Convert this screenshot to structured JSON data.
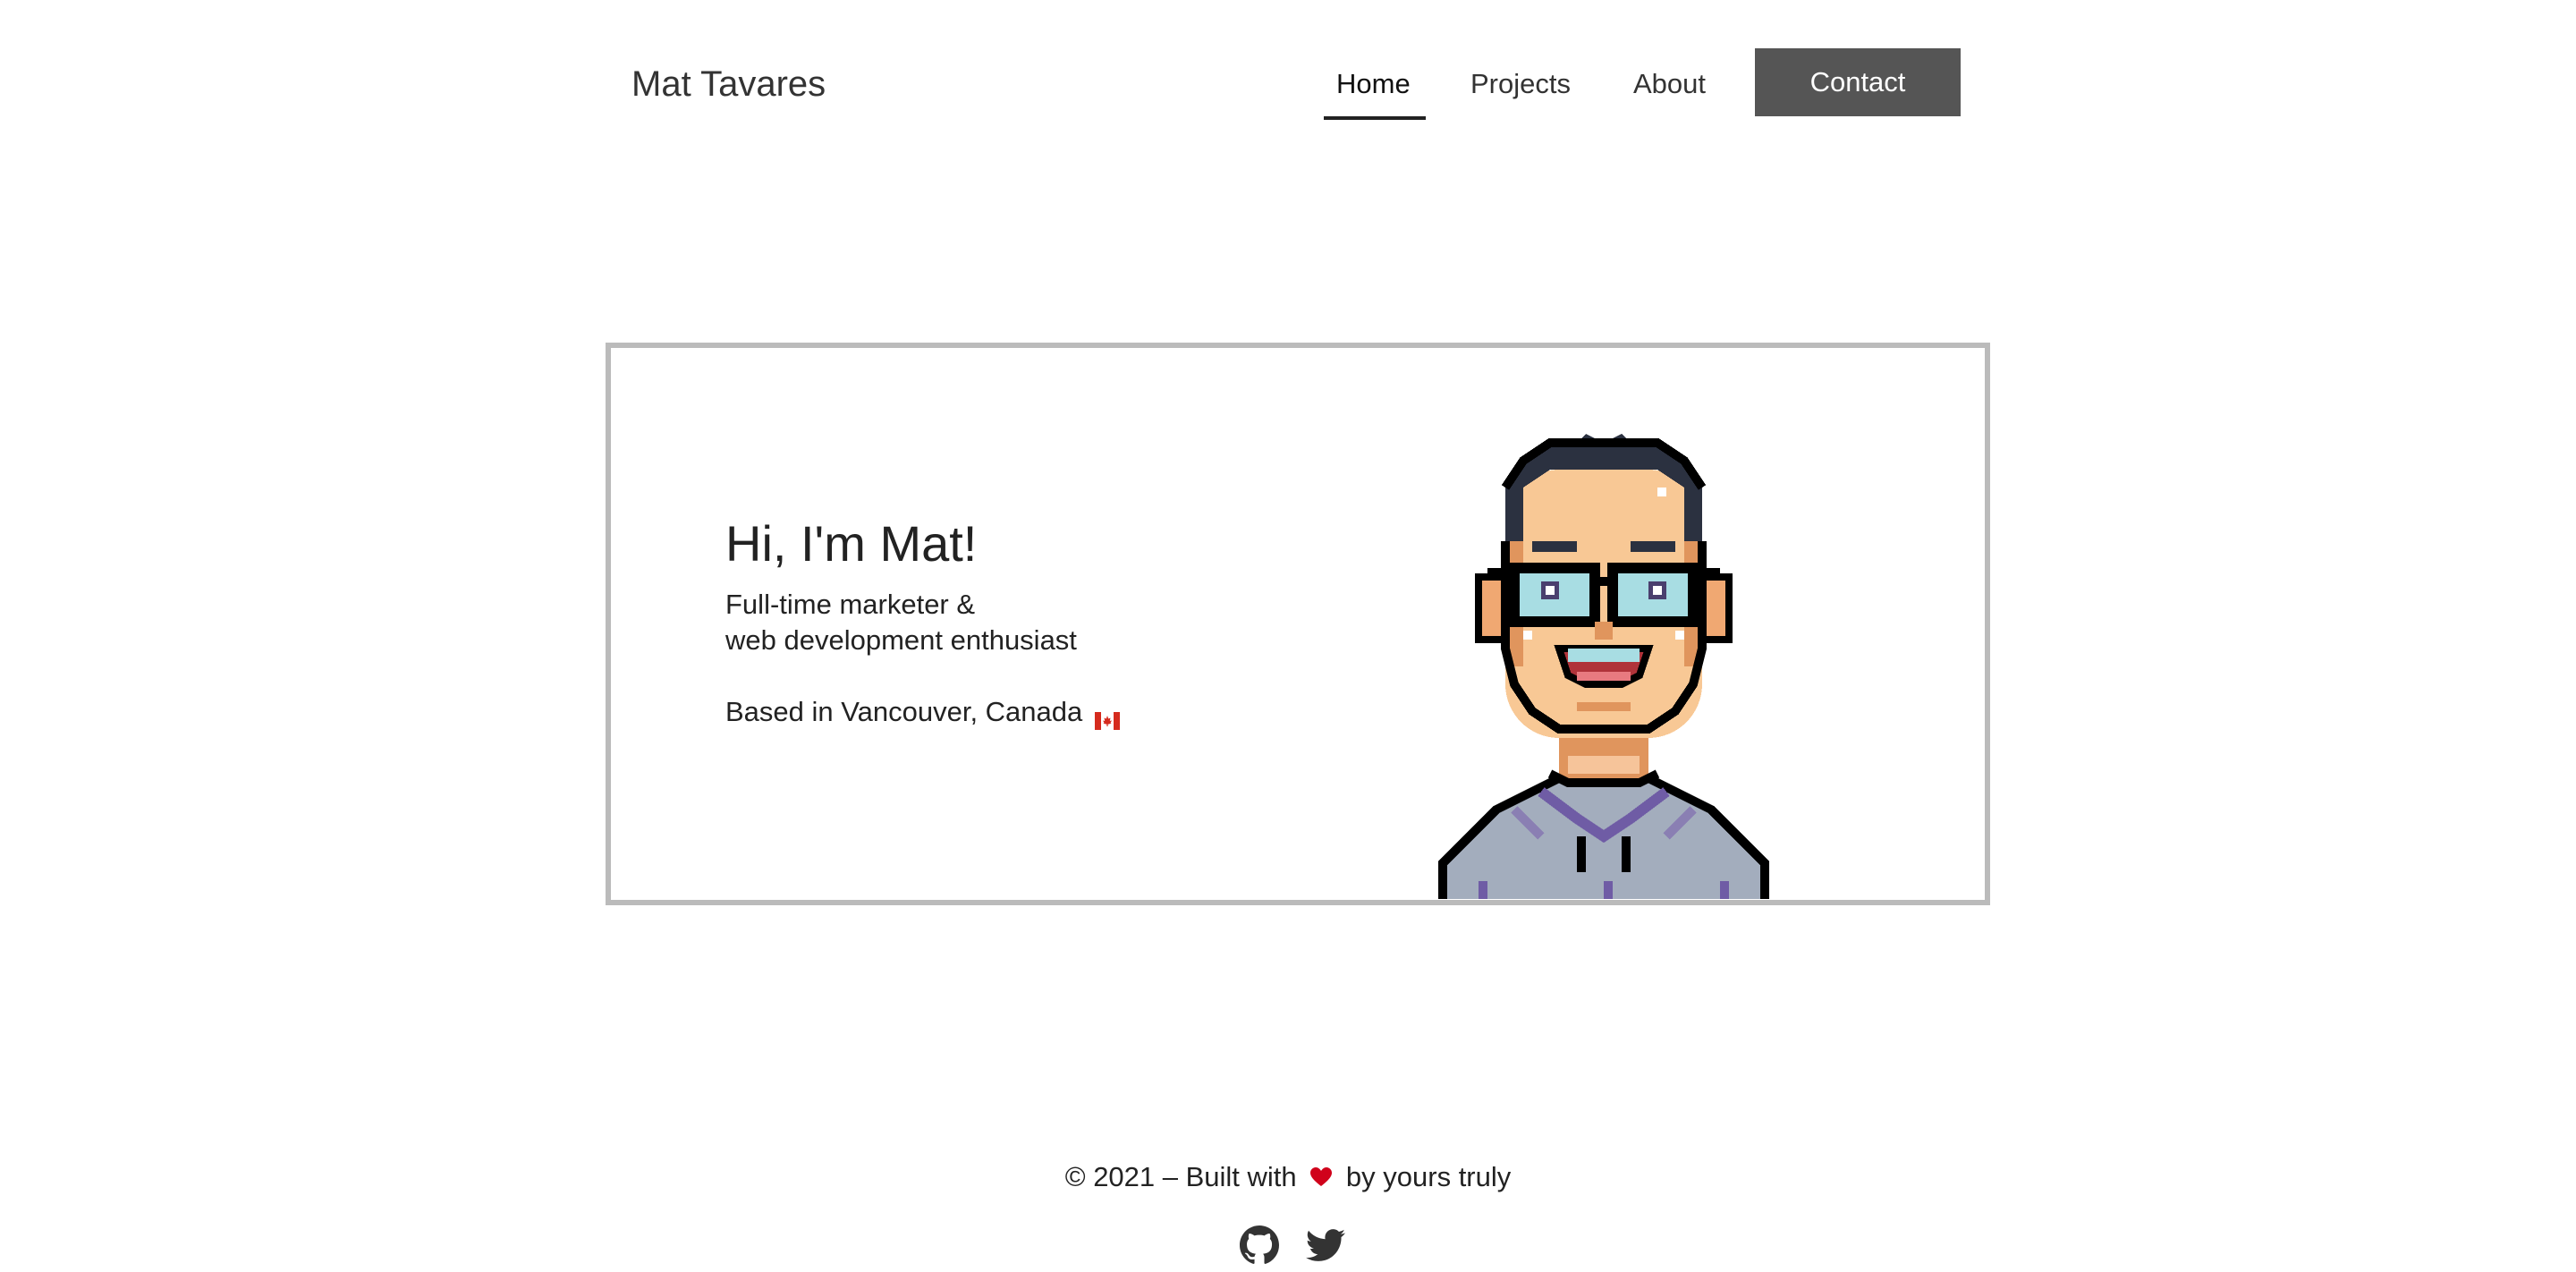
{
  "header": {
    "brand": "Mat Tavares",
    "nav": {
      "home": "Home",
      "projects": "Projects",
      "about": "About",
      "contact": "Contact"
    },
    "active_item": "Home"
  },
  "hero": {
    "title": "Hi, I'm Mat!",
    "tagline_line1": "Full-time marketer &",
    "tagline_line2": "web development enthusiast",
    "location": "Based in Vancouver, Canada",
    "location_icon": "canada-flag-icon",
    "image": "pixel-art-avatar"
  },
  "footer": {
    "copyright_prefix": "© 2021 – Built with",
    "copyright_suffix": "by yours truly",
    "heart_icon": "heart-icon",
    "social": [
      "github-icon",
      "twitter-icon"
    ]
  },
  "colors": {
    "contact_button_bg": "#555555",
    "card_border": "#bbbbbb",
    "text": "#222222"
  }
}
